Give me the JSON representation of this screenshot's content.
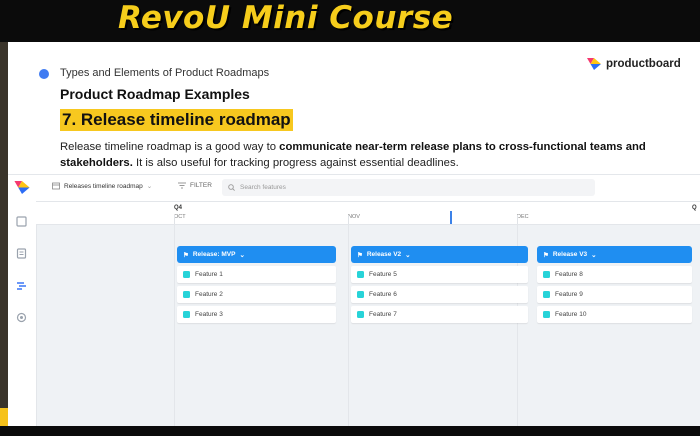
{
  "banner": {
    "title": "RevoU Mini Course"
  },
  "slide": {
    "section": "Types and Elements of Product Roadmaps",
    "heading": "Product Roadmap Examples",
    "subheading": "7. Release timeline roadmap",
    "desc_a": "Release timeline roadmap is a good way to ",
    "desc_bold": "communicate near-term release plans to cross-functional teams and stakeholders.",
    "desc_b": " It is also useful for tracking progress against essential deadlines.",
    "brand": "productboard"
  },
  "app": {
    "view_name": "Releases timeline roadmap",
    "filter_label": "FILTER",
    "search_placeholder": "Search features",
    "quarter": "Q4",
    "quarter_next": "Q",
    "months": [
      "OCT",
      "NOV",
      "DEC"
    ],
    "releases": [
      {
        "name": "Release: MVP",
        "features": [
          "Feature 1",
          "Feature 2",
          "Feature 3"
        ]
      },
      {
        "name": "Release V2",
        "features": [
          "Feature 5",
          "Feature 6",
          "Feature 7"
        ]
      },
      {
        "name": "Release V3",
        "features": [
          "Feature 8",
          "Feature 9",
          "Feature 10"
        ]
      }
    ],
    "colors": {
      "release_header": "#1f8ef1",
      "feature_dot": "#27d3d8",
      "highlight": "#f7c81f"
    }
  }
}
